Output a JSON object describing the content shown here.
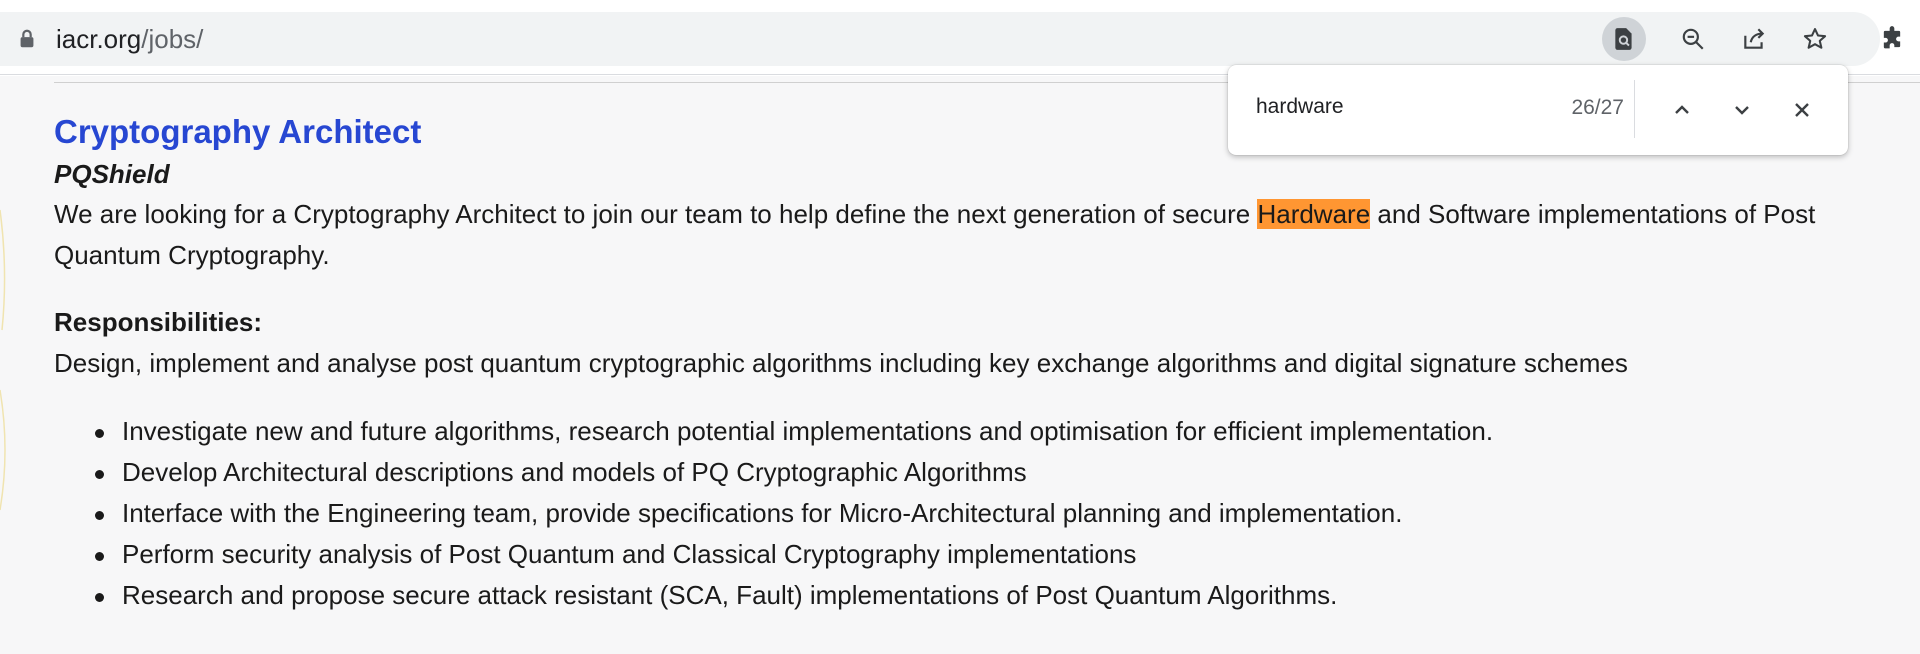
{
  "browser": {
    "url_host": "iacr.org",
    "url_path": "/jobs/",
    "icons": [
      "lock-icon",
      "find-in-page-icon",
      "zoom-out-icon",
      "share-icon",
      "star-icon",
      "extensions-icon"
    ]
  },
  "find_bar": {
    "query": "hardware",
    "match_count": "26/27",
    "icons": [
      "chevron-up-icon",
      "chevron-down-icon",
      "close-icon"
    ]
  },
  "job": {
    "title": "Cryptography Architect",
    "company": "PQShield",
    "intro_before": "We are looking for a Cryptography Architect to join our team to help define the next generation of secure ",
    "intro_highlight": "Hardware",
    "intro_after_line1": " and Software implementations of Post",
    "intro_line2": "Quantum Cryptography.",
    "responsibilities_heading": "Responsibilities:",
    "responsibilities_description": "Design, implement and analyse post quantum cryptographic algorithms including key exchange algorithms and digital signature schemes",
    "bullets": [
      "Investigate new and future algorithms, research potential implementations and optimisation for efficient implementation.",
      "Develop Architectural descriptions and models of PQ Cryptographic Algorithms",
      "Interface with the Engineering team, provide specifications for Micro-Architectural planning and implementation.",
      "Perform security analysis of Post Quantum and Classical Cryptography implementations",
      "Research and propose secure attack resistant (SCA, Fault) implementations of Post Quantum Algorithms."
    ]
  },
  "colors": {
    "title_link": "#2747d2",
    "find_highlight": "#ff9632",
    "active_button": "#cfd3d7"
  }
}
